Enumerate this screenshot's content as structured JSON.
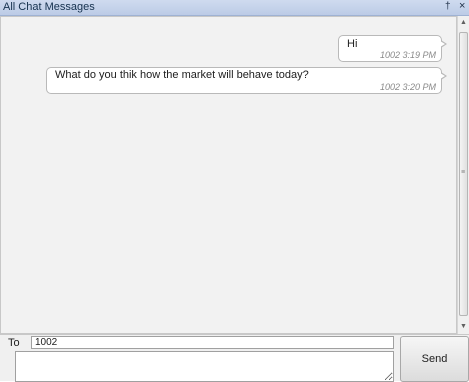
{
  "window": {
    "title": "All Chat Messages",
    "pin_glyph": "†",
    "close_glyph": "×",
    "icons": [
      "pin-icon",
      "close-icon"
    ]
  },
  "messages": [
    {
      "text": "Hi",
      "meta": "1002 3:19 PM"
    },
    {
      "text": "What do you thik how the market will behave today?",
      "meta": "1002 3:20 PM"
    }
  ],
  "scrollbar": {
    "up_glyph": "▲",
    "down_glyph": "▼",
    "grip_glyph": "≡"
  },
  "compose": {
    "to_label": "To",
    "to_value": "1002",
    "message_value": "",
    "send_label": "Send"
  }
}
